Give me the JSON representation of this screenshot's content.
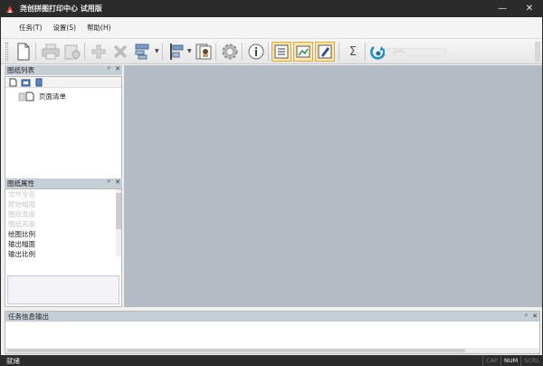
{
  "window": {
    "title": "尧创拼图打印中心 试用版",
    "min_glyph": "—",
    "close_glyph": "✕"
  },
  "menu": {
    "items": [
      {
        "label": "任务(T)"
      },
      {
        "label": "设置(S)"
      },
      {
        "label": "帮助(H)"
      }
    ]
  },
  "toolbar": {
    "progress_text": "10%",
    "progress_value": 0.1,
    "buttons": [
      {
        "name": "new-file",
        "icon": "blank-page-icon",
        "enabled": true
      },
      {
        "name": "print",
        "icon": "printer-icon",
        "enabled": false
      },
      {
        "name": "print-setup",
        "icon": "printer-settings-icon",
        "enabled": false
      },
      {
        "name": "add",
        "icon": "plus-icon",
        "enabled": false
      },
      {
        "name": "delete",
        "icon": "x-icon",
        "enabled": false
      },
      {
        "name": "layout",
        "icon": "layout-icon",
        "enabled": true
      },
      {
        "name": "align",
        "icon": "align-icon",
        "enabled": true
      },
      {
        "name": "properties",
        "icon": "document-settings-icon",
        "enabled": true
      },
      {
        "name": "options",
        "icon": "gear-icon",
        "enabled": true
      },
      {
        "name": "info",
        "icon": "info-icon",
        "enabled": true
      },
      {
        "name": "list-view",
        "icon": "list-icon",
        "enabled": true,
        "checked": true
      },
      {
        "name": "image-view",
        "icon": "image-icon",
        "enabled": true,
        "checked": true
      },
      {
        "name": "edit",
        "icon": "pencil-icon",
        "enabled": true,
        "checked": true
      },
      {
        "name": "sum",
        "icon": "sigma-icon",
        "enabled": true
      },
      {
        "name": "go",
        "icon": "arrow-circle-icon",
        "enabled": true
      }
    ],
    "sigma_glyph": "Σ"
  },
  "drawing_list": {
    "title": "图纸列表",
    "pin_glyph": "ᵖ",
    "close_glyph": "✕",
    "tree_item": "页面清单"
  },
  "properties": {
    "title": "图纸属性",
    "pin_glyph": "ᵖ",
    "close_glyph": "✕",
    "rows": [
      {
        "label": "文件全名",
        "disabled": true
      },
      {
        "label": "原始幅面",
        "disabled": true
      },
      {
        "label": "图纸宽度",
        "disabled": true
      },
      {
        "label": "图纸高度",
        "disabled": true
      },
      {
        "label": "绘图比例",
        "disabled": false
      },
      {
        "label": "输出幅面",
        "disabled": false
      },
      {
        "label": "输出比例",
        "disabled": false
      }
    ]
  },
  "output": {
    "title": "任务信息输出",
    "pin_glyph": "ᵖ",
    "close_glyph": "✕"
  },
  "status": {
    "text": "就绪",
    "indicators": [
      {
        "label": "CAP",
        "active": false
      },
      {
        "label": "NUM",
        "active": true
      },
      {
        "label": "SCRL",
        "active": false
      }
    ]
  },
  "colors": {
    "titlebar": "#2b2b2b",
    "workspace": "#b5bbc4",
    "pane_header": "#c6ced6",
    "checked_bg": "#fbe8b0"
  }
}
